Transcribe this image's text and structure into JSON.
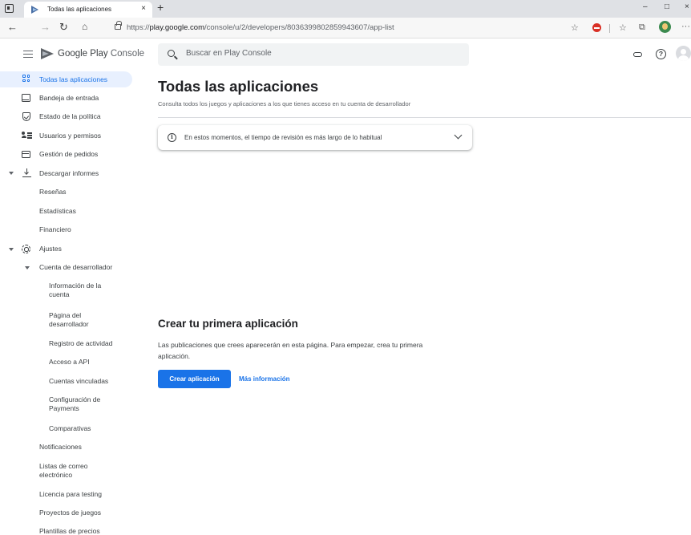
{
  "browser": {
    "tab_title": "Todas las aplicaciones",
    "tab_close": "×",
    "new_tab": "+",
    "minimize": "–",
    "maximize": "□",
    "close": "×",
    "url_prefix": "https://",
    "url_host": "play.google.com",
    "url_path": "/console/u/2/developers/8036399802859943607/app-list",
    "more_menu": "···"
  },
  "header": {
    "brand_bold": "Google Play",
    "brand_rest": " Console",
    "search_placeholder": "Buscar en Play Console",
    "help": "?"
  },
  "sidebar": {
    "items": [
      {
        "label": "Todas las aplicaciones",
        "icon": "grid-icon",
        "active": true
      },
      {
        "label": "Bandeja de entrada",
        "icon": "inbox-icon"
      },
      {
        "label": "Estado de la política",
        "icon": "shield-icon"
      },
      {
        "label": "Usuarios y permisos",
        "icon": "users-icon"
      },
      {
        "label": "Gestión de pedidos",
        "icon": "card-icon"
      },
      {
        "label": "Descargar informes",
        "icon": "download-icon",
        "expanded": true
      },
      {
        "label": "Reseñas"
      },
      {
        "label": "Estadísticas"
      },
      {
        "label": "Financiero"
      },
      {
        "label": "Ajustes",
        "icon": "gear-icon",
        "expanded": true
      },
      {
        "label": "Cuenta de desarrollador",
        "expanded": true
      },
      {
        "label": "Información de la cuenta"
      },
      {
        "label": "Página del desarrollador"
      },
      {
        "label": "Registro de actividad"
      },
      {
        "label": "Acceso a API"
      },
      {
        "label": "Cuentas vinculadas"
      },
      {
        "label": "Configuración de Payments"
      },
      {
        "label": "Comparativas"
      },
      {
        "label": "Notificaciones"
      },
      {
        "label": "Listas de correo electrónico"
      },
      {
        "label": "Licencia para testing"
      },
      {
        "label": "Proyectos de juegos"
      },
      {
        "label": "Plantillas de precios"
      }
    ]
  },
  "main": {
    "title": "Todas las aplicaciones",
    "subtitle": "Consulta todos los juegos y aplicaciones a los que tienes acceso en tu cuenta de desarrollador",
    "banner_text": "En estos momentos, el tiempo de revisión es más largo de lo habitual",
    "info_glyph": "i",
    "empty_title": "Crear tu primera aplicación",
    "empty_desc": "Las publicaciones que crees aparecerán en esta página. Para empezar, crea tu primera aplicación.",
    "create_button": "Crear aplicación",
    "more_info": "Más información"
  },
  "colors": {
    "accent": "#1a73e8",
    "active_bg": "#e8f0fe"
  }
}
